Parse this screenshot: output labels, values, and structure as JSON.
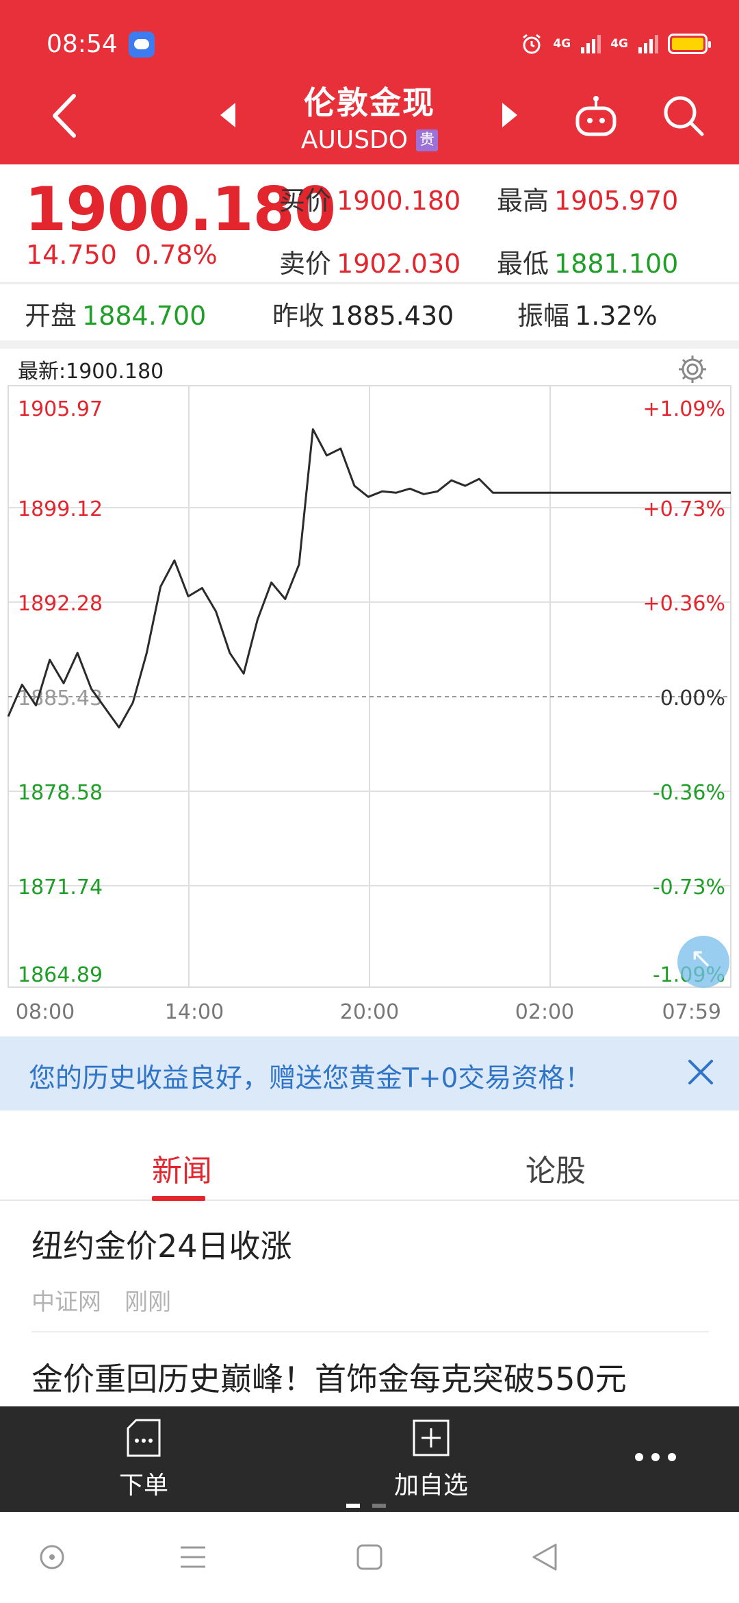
{
  "status_bar": {
    "time": "08:54",
    "signal1": "4G",
    "signal2": "4G"
  },
  "header": {
    "title": "伦敦金现",
    "symbol": "AUUSDO",
    "tag": "贵"
  },
  "quote": {
    "price": "1900.180",
    "change": "14.750",
    "change_pct": "0.78%",
    "bid_label": "买价",
    "bid": "1900.180",
    "ask_label": "卖价",
    "ask": "1902.030",
    "high_label": "最高",
    "high": "1905.970",
    "low_label": "最低",
    "low": "1881.100",
    "open_label": "开盘",
    "open": "1884.700",
    "prev_close_label": "昨收",
    "prev_close": "1885.430",
    "amplitude_label": "振幅",
    "amplitude": "1.32%"
  },
  "chart": {
    "latest_label": "最新:1900.180"
  },
  "chart_data": {
    "type": "line",
    "title": "",
    "xlabel": "",
    "ylabel": "",
    "x_ticks": [
      "08:00",
      "14:00",
      "20:00",
      "02:00",
      "07:59"
    ],
    "y_ticks_left": [
      "1905.97",
      "1899.12",
      "1892.28",
      "1885.43",
      "1878.58",
      "1871.74",
      "1864.89"
    ],
    "y_ticks_right": [
      "+1.09%",
      "+0.73%",
      "+0.36%",
      "0.00%",
      "-0.36%",
      "-0.73%",
      "-1.09%"
    ],
    "ylim": [
      1864.89,
      1905.97
    ],
    "reference_line": 1885.43,
    "grid": true,
    "series": [
      {
        "x": [
          "08:00",
          "08:30",
          "09:00",
          "09:30",
          "10:00",
          "10:30",
          "11:00",
          "11:30",
          "12:00",
          "12:30",
          "13:00",
          "13:30",
          "14:00",
          "14:30",
          "15:00",
          "15:30",
          "16:00",
          "16:30",
          "17:00",
          "17:30",
          "18:00",
          "18:30",
          "19:00",
          "19:30",
          "20:00",
          "20:30",
          "21:00",
          "21:30",
          "22:00",
          "22:30",
          "23:00",
          "23:30",
          "00:00",
          "00:30",
          "01:00",
          "01:30",
          "02:00",
          "02:30",
          "03:00",
          "03:30",
          "04:00",
          "04:30",
          "05:00",
          "05:30",
          "06:00",
          "06:30",
          "07:00",
          "07:30",
          "07:59"
        ],
        "y": [
          1884.0,
          1886.3,
          1884.8,
          1888.1,
          1886.4,
          1888.6,
          1886.0,
          1884.6,
          1883.2,
          1885.0,
          1888.6,
          1893.4,
          1895.3,
          1892.7,
          1893.3,
          1891.6,
          1888.6,
          1887.1,
          1891.0,
          1893.7,
          1892.5,
          1895.0,
          1904.8,
          1902.9,
          1903.4,
          1900.7,
          1899.9,
          1900.3,
          1900.2,
          1900.5,
          1900.1,
          1900.3,
          1901.1,
          1900.7,
          1901.2,
          1900.2,
          1900.2,
          1900.2,
          1900.2,
          1900.2,
          1900.2,
          1900.2,
          1900.2,
          1900.2,
          1900.2,
          1900.2,
          1900.2,
          1900.2,
          1900.2
        ]
      }
    ]
  },
  "banner": {
    "text": "您的历史收益良好，赠送您黄金T+0交易资格！"
  },
  "tabs": [
    {
      "label": "新闻"
    },
    {
      "label": "论股"
    }
  ],
  "news": [
    {
      "title": "纽约金价24日收涨",
      "source": "中证网",
      "time": "刚刚"
    },
    {
      "title": "金价重回历史巅峰！首饰金每克突破550元"
    }
  ],
  "bottom_bar": {
    "order_label": "下单",
    "watchlist_label": "加自选"
  },
  "colors": {
    "header_red": "#e8303a",
    "up_red": "#e3252e",
    "down_green": "#1f9e28",
    "banner_bg": "#dce9f8",
    "banner_text": "#2f74c6"
  }
}
